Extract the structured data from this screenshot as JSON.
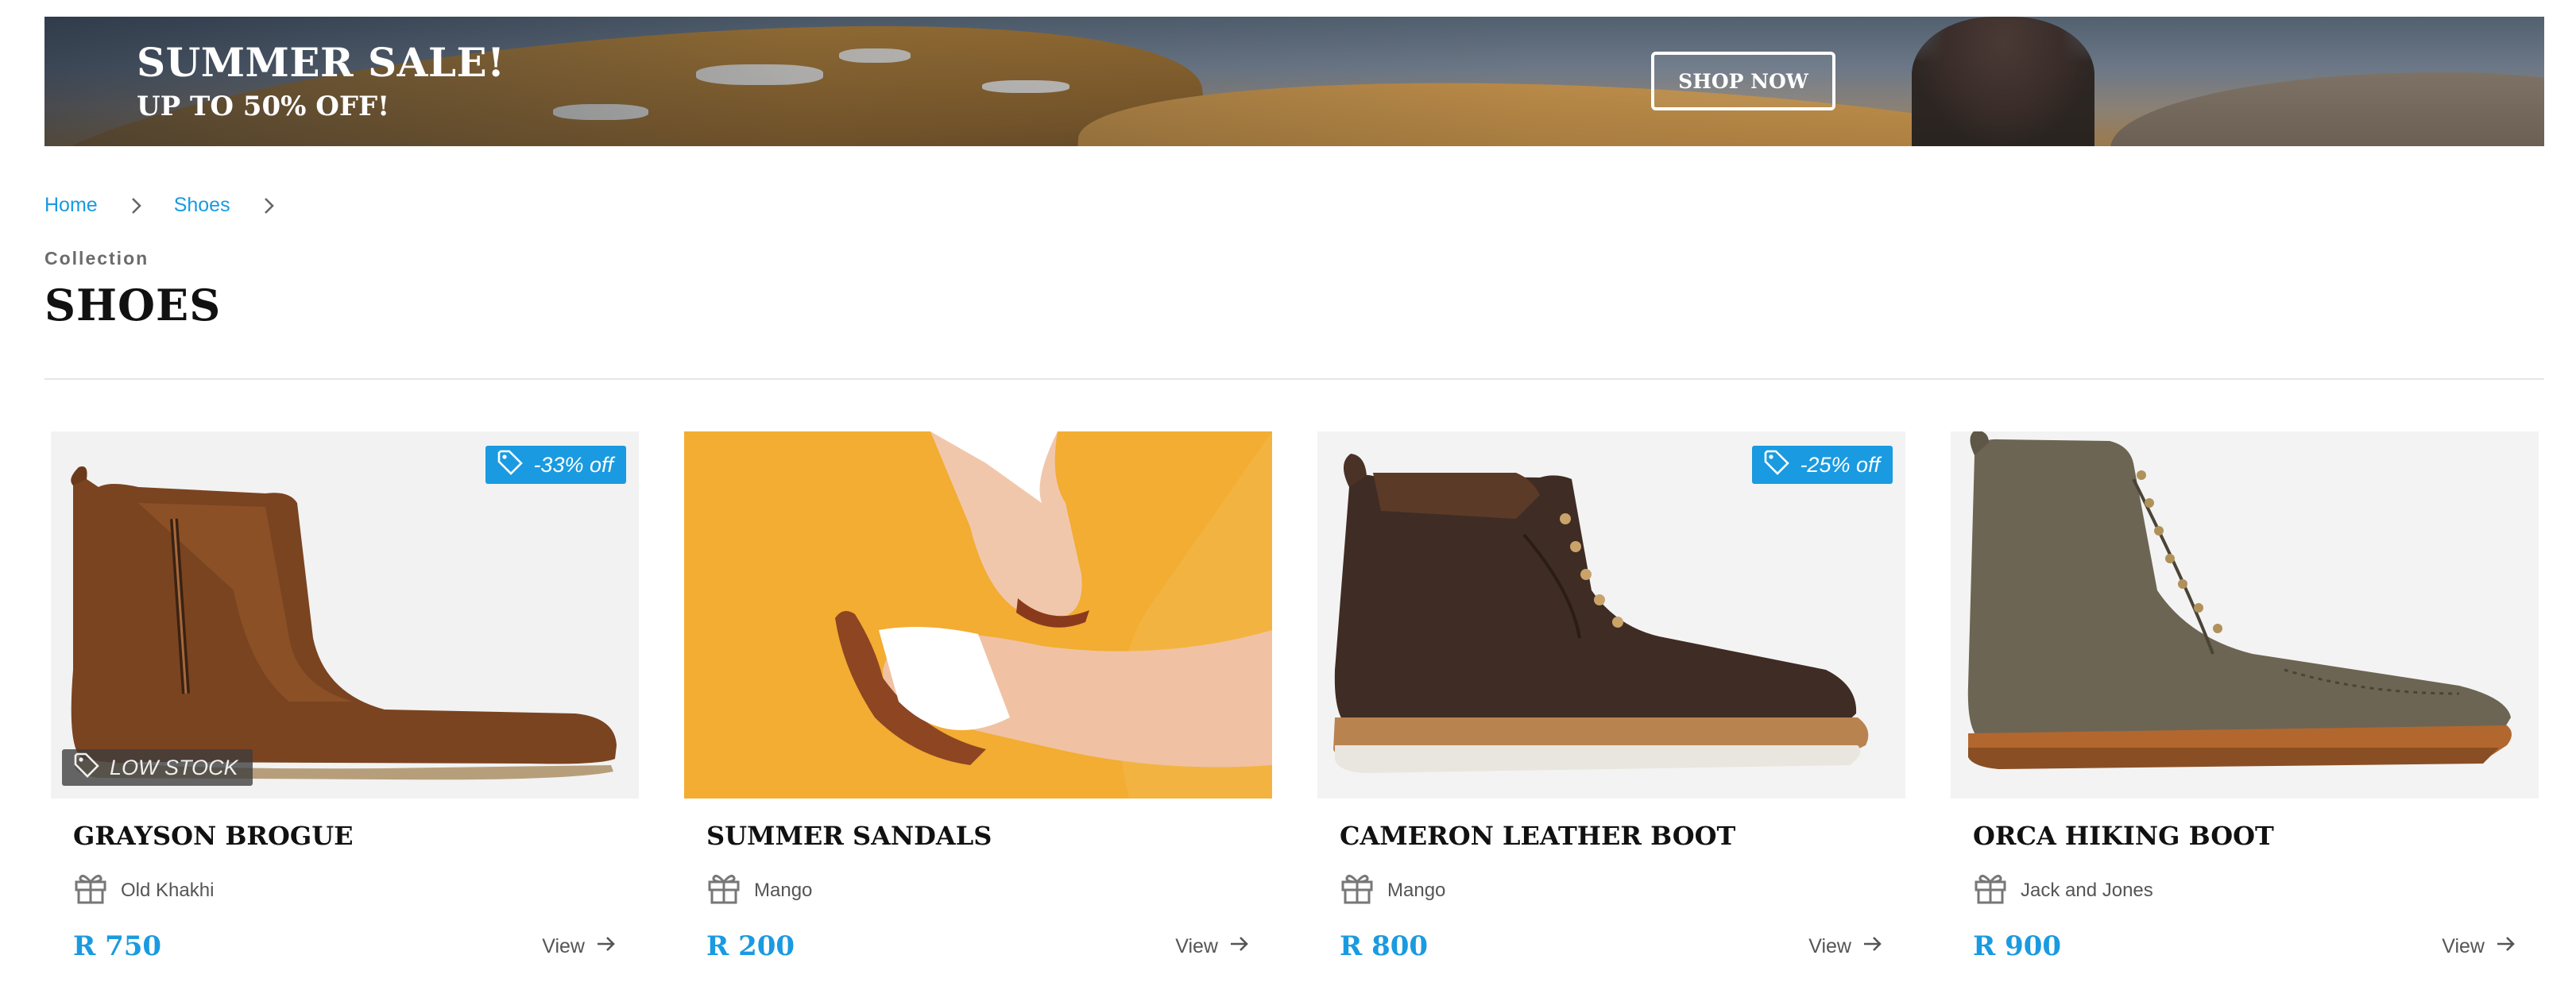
{
  "banner": {
    "title": "SUMMER SALE!",
    "subtitle": "UP TO 50% OFF!",
    "cta_label": "SHOP NOW"
  },
  "breadcrumb": {
    "items": [
      "Home",
      "Shoes"
    ]
  },
  "collection": {
    "label": "Collection",
    "title": "SHOES"
  },
  "colors": {
    "accent": "#1a9ae0",
    "stock_badge": "#3c3c3c",
    "sandal_bg": "#f2ad32"
  },
  "products": [
    {
      "name": "GRAYSON BROGUE",
      "brand": "Old Khakhi",
      "price": "R 750",
      "view_label": "View",
      "discount": "-33% off",
      "stock": "LOW STOCK"
    },
    {
      "name": "SUMMER SANDALS",
      "brand": "Mango",
      "price": "R 200",
      "view_label": "View"
    },
    {
      "name": "CAMERON LEATHER BOOT",
      "brand": "Mango",
      "price": "R 800",
      "view_label": "View",
      "discount": "-25% off"
    },
    {
      "name": "ORCA HIKING BOOT",
      "brand": "Jack and Jones",
      "price": "R 900",
      "view_label": "View"
    }
  ]
}
